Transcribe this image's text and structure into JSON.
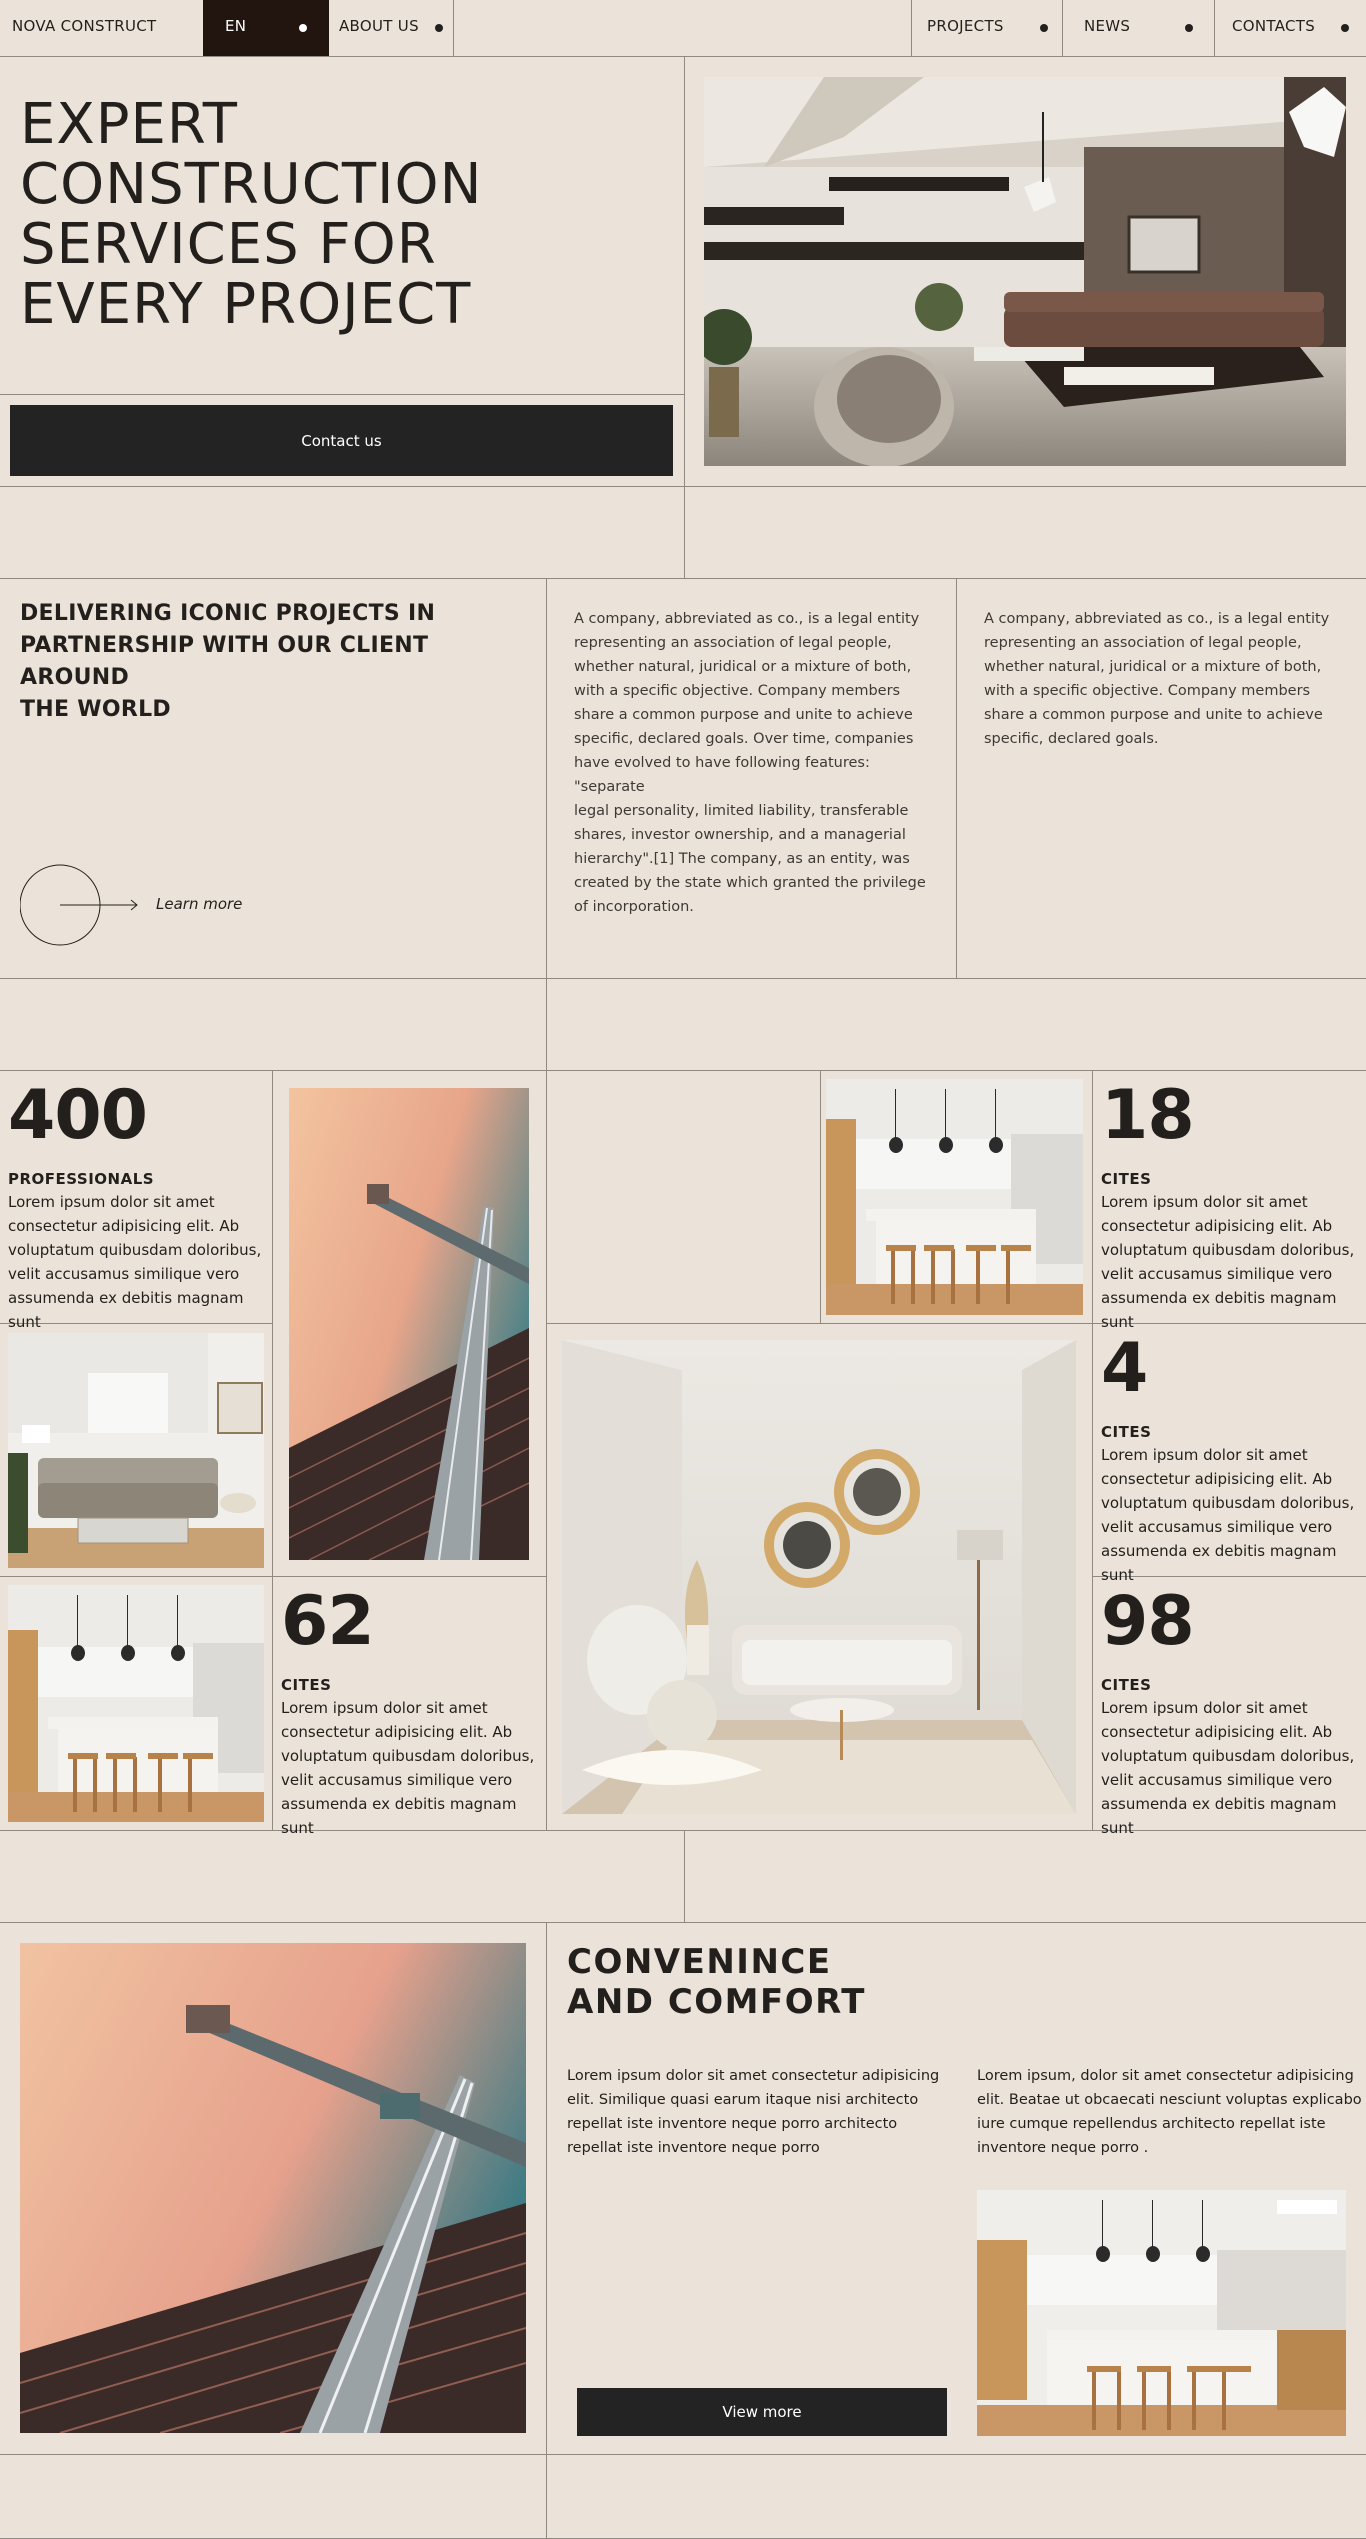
{
  "nav": {
    "brand": "NOVA CONSTRUCT",
    "lang": "EN",
    "about": "ABOUT US",
    "projects": "PROJECTS",
    "news": "NEWS",
    "contacts": "CONTACTS"
  },
  "hero": {
    "title_lines": [
      "EXPERT",
      "CONSTRUCTION",
      "SERVICES FOR",
      "EVERY PROJECT"
    ],
    "cta": "Contact us"
  },
  "about": {
    "heading_lines": [
      "DELIVERING ICONIC PROJECTS IN",
      "PARTNERSHIP WITH OUR CLIENT AROUND",
      "THE WORLD"
    ],
    "learn_more": "Learn more",
    "col1_lines": [
      "A company, abbreviated as co., is a legal entity",
      "representing an association of legal people,",
      "whether natural, juridical or a mixture of both,",
      "with a specific objective. Company members",
      "share a common purpose and unite to achieve",
      "specific, declared goals. Over time, companies",
      "have evolved to have following features: \"separate",
      "legal personality, limited liability, transferable",
      "shares, investor ownership, and a managerial",
      "hierarchy\".[1] The company, as an entity, was",
      "created by the state which granted the privilege",
      "of incorporation."
    ],
    "col2_lines": [
      "A company, abbreviated as co., is a legal entity",
      "representing an association of legal people,",
      "whether natural, juridical or a mixture of both,",
      "with a specific objective. Company members",
      "share a common purpose and unite to achieve",
      "specific, declared goals."
    ]
  },
  "stats": {
    "lorem_lines": [
      "Lorem ipsum dolor sit amet",
      "consectetur adipisicing elit. Ab",
      "voluptatum quibusdam doloribus,",
      "velit accusamus similique vero",
      "assumenda ex debitis magnam sunt"
    ],
    "s400": {
      "num": "400",
      "label": "PROFESSIONALS"
    },
    "s18": {
      "num": "18",
      "label": "CITES"
    },
    "s4": {
      "num": "4",
      "label": "CITES"
    },
    "s62": {
      "num": "62",
      "label": "CITES"
    },
    "s98": {
      "num": "98",
      "label": "CITES"
    }
  },
  "comfort": {
    "heading_lines": [
      "CONVENINCE",
      "AND COMFORT"
    ],
    "col1_lines": [
      "Lorem ipsum dolor sit amet consectetur adipisicing",
      "elit. Similique quasi earum itaque nisi architecto",
      "repellat iste inventore neque porro architecto",
      "repellat iste inventore neque porro"
    ],
    "col2_lines": [
      "Lorem ipsum, dolor sit amet consectetur adipisicing",
      "elit. Beatae ut obcaecati nesciunt voluptas explicabo",
      "iure cumque repellendus architecto repellat iste",
      "inventore neque porro ."
    ],
    "cta": "View more"
  },
  "colors": {
    "background": "#ebe3d9",
    "dark": "#232323",
    "en_bg": "#221510",
    "line": "#8f8982"
  }
}
